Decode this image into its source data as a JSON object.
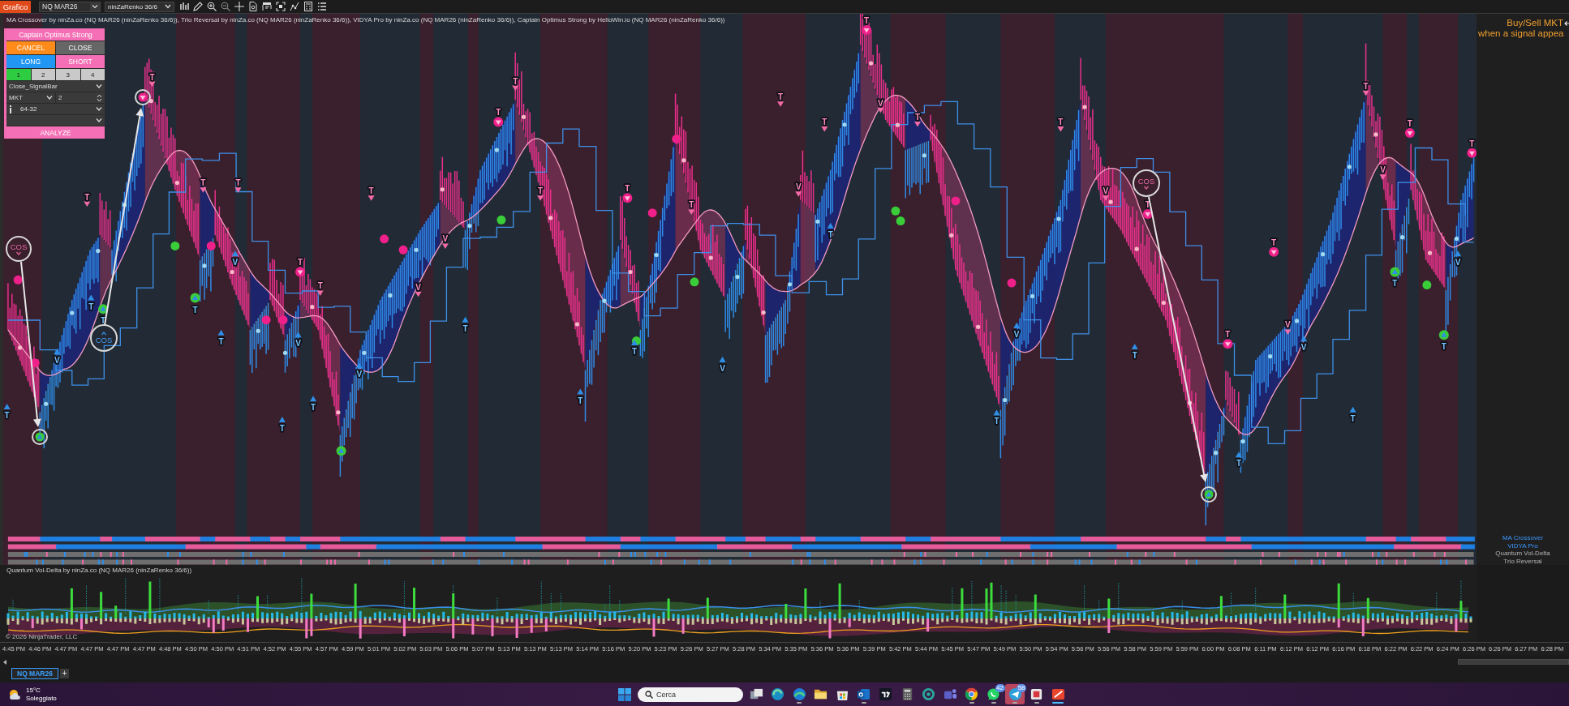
{
  "toolbar": {
    "window_tab": "Grafico",
    "instrument": "NQ MAR26",
    "bar_type": "ninZaRenko 36/6"
  },
  "chart": {
    "title": "MA Crossover by ninZa.co (NQ MAR26 (ninZaRenko 36/6)), Trio Reversal by ninZa.co (NQ MAR26 (ninZaRenko 36/6)), VIDYA Pro by ninZa.co (NQ MAR26 (ninZaRenko 36/6)), Captain Optimus Strong by HelloWin.io (NQ MAR26 (ninZaRenko 36/6))",
    "notice": [
      "Buy/Sell MKT",
      "when a signal appea"
    ],
    "annotations": [
      {
        "label": "COS",
        "kind": "sell"
      },
      {
        "label": "COS",
        "kind": "buy"
      },
      {
        "label": "COS",
        "kind": "sell"
      }
    ],
    "signals": [
      {
        "kind": "buy",
        "label": "T"
      },
      {
        "kind": "buy",
        "label": "V"
      },
      {
        "kind": "sell",
        "label": "T"
      },
      {
        "kind": "buy",
        "label": "T"
      },
      {
        "kind": "buycircle",
        "label": "T"
      },
      {
        "kind": "sell",
        "label": "T"
      },
      {
        "kind": "buycircle",
        "label": "T"
      },
      {
        "kind": "sell",
        "label": "T"
      },
      {
        "kind": "buy",
        "label": "T"
      },
      {
        "kind": "buy",
        "label": "V"
      },
      {
        "kind": "sell",
        "label": "T"
      },
      {
        "kind": "buy",
        "label": "T"
      },
      {
        "kind": "buy",
        "label": "V"
      },
      {
        "kind": "sellcircle",
        "label": "T"
      },
      {
        "kind": "buy",
        "label": "T"
      },
      {
        "kind": "sell",
        "label": "T"
      },
      {
        "kind": "buy",
        "label": "V"
      },
      {
        "kind": "sell",
        "label": "T"
      },
      {
        "kind": "sell",
        "label": "V"
      },
      {
        "kind": "sell",
        "label": "V"
      },
      {
        "kind": "buy",
        "label": "T"
      },
      {
        "kind": "sellcircle",
        "label": "T"
      },
      {
        "kind": "sell",
        "label": "T"
      },
      {
        "kind": "sell",
        "label": "T"
      },
      {
        "kind": "buy",
        "label": "T"
      },
      {
        "kind": "sellcircle",
        "label": "T"
      },
      {
        "kind": "buy",
        "label": "T"
      },
      {
        "kind": "sell",
        "label": "T"
      },
      {
        "kind": "buy",
        "label": "V"
      },
      {
        "kind": "sell",
        "label": "T"
      },
      {
        "kind": "sell",
        "label": "V"
      },
      {
        "kind": "sell",
        "label": "T"
      },
      {
        "kind": "buy",
        "label": "T"
      },
      {
        "kind": "sellcircle",
        "label": "T"
      },
      {
        "kind": "sell",
        "label": "V"
      },
      {
        "kind": "sell",
        "label": "T"
      },
      {
        "kind": "buy",
        "label": "T"
      },
      {
        "kind": "buy",
        "label": "V"
      },
      {
        "kind": "sell",
        "label": "T"
      },
      {
        "kind": "sell",
        "label": "V"
      },
      {
        "kind": "buy",
        "label": "T"
      },
      {
        "kind": "sellcircle",
        "label": "T"
      },
      {
        "kind": "sellcircle",
        "label": "T"
      },
      {
        "kind": "buy",
        "label": "T"
      },
      {
        "kind": "sellcircle",
        "label": "T"
      },
      {
        "kind": "sell",
        "label": "V"
      },
      {
        "kind": "buy",
        "label": "V"
      },
      {
        "kind": "buy",
        "label": "T"
      },
      {
        "kind": "sell",
        "label": "T"
      },
      {
        "kind": "sell",
        "label": "V"
      },
      {
        "kind": "buycircle",
        "label": "T"
      },
      {
        "kind": "sellcircle",
        "label": "T"
      },
      {
        "kind": "buycircle",
        "label": "T"
      },
      {
        "kind": "buy",
        "label": "V"
      },
      {
        "kind": "sellcircle",
        "label": "T"
      }
    ]
  },
  "order_panel": {
    "title": "Captain Optimus Strong",
    "buttons": [
      {
        "label": "CANCEL",
        "kind": "cancel"
      },
      {
        "label": "CLOSE",
        "kind": "close"
      },
      {
        "label": "LONG",
        "kind": "long"
      },
      {
        "label": "SHORT",
        "kind": "short"
      }
    ],
    "presets": [
      {
        "label": "1",
        "selected": true
      },
      {
        "label": "2",
        "selected": false
      },
      {
        "label": "3",
        "selected": false
      },
      {
        "label": "4",
        "selected": false
      }
    ],
    "exit_mode": "Close_SignalBar",
    "order_type": "MKT",
    "quantity": "2",
    "ratio": "64-32",
    "analyze": "ANALYZE"
  },
  "strips": [
    {
      "label": "MA Crossover",
      "kind": "trend"
    },
    {
      "label": "VIDYA Pro",
      "kind": "trend"
    },
    {
      "label": "Quantum Vol-Delta",
      "kind": "ticks"
    },
    {
      "label": "Trio Reversal",
      "kind": "ticks"
    }
  ],
  "lower_panel": {
    "title": "Quantum Vol-Delta by ninZa.co (NQ MAR26 (ninZaRenko 36/6))",
    "copyright": "© 2026 NinjaTrader, LLC"
  },
  "time_axis": [
    "4:45 PM",
    "4:46 PM",
    "4:47 PM",
    "4:47 PM",
    "4:47 PM",
    "4:47 PM",
    "4:48 PM",
    "4:50 PM",
    "4:50 PM",
    "4:51 PM",
    "4:52 PM",
    "4:55 PM",
    "4:57 PM",
    "4:59 PM",
    "5:01 PM",
    "5:02 PM",
    "5:03 PM",
    "5:06 PM",
    "5:07 PM",
    "5:13 PM",
    "5:13 PM",
    "5:13 PM",
    "5:14 PM",
    "5:16 PM",
    "5:20 PM",
    "5:23 PM",
    "5:26 PM",
    "5:27 PM",
    "5:28 PM",
    "5:34 PM",
    "5:35 PM",
    "5:36 PM",
    "5:36 PM",
    "5:39 PM",
    "5:42 PM",
    "5:44 PM",
    "5:45 PM",
    "5:47 PM",
    "5:49 PM",
    "5:50 PM",
    "5:54 PM",
    "5:56 PM",
    "5:56 PM",
    "5:58 PM",
    "5:59 PM",
    "5:59 PM",
    "6:00 PM",
    "6:08 PM",
    "6:11 PM",
    "6:12 PM",
    "6:12 PM",
    "6:16 PM",
    "6:18 PM",
    "6:22 PM",
    "6:22 PM",
    "6:24 PM",
    "6:26 PM",
    "6:26 PM",
    "6:27 PM",
    "6:28 PM"
  ],
  "tabs": [
    {
      "label": "NQ MAR26",
      "selected": true
    }
  ],
  "add_tab": "+",
  "taskbar": {
    "weather": {
      "temperature": "15°C",
      "condition": "Soleggiato"
    },
    "search": {
      "placeholder": "Cerca"
    },
    "apps": [
      {
        "kind": "taskview",
        "running": false,
        "focused": false,
        "flashing": false
      },
      {
        "kind": "swirl",
        "running": false,
        "focused": false,
        "flashing": false
      },
      {
        "kind": "wave",
        "running": true,
        "focused": false,
        "flashing": false
      },
      {
        "kind": "folder",
        "running": false,
        "focused": false,
        "flashing": false
      },
      {
        "kind": "bag",
        "running": false,
        "focused": false,
        "flashing": false
      },
      {
        "kind": "mail",
        "running": true,
        "focused": false,
        "flashing": false
      },
      {
        "kind": "tile",
        "running": false,
        "focused": false,
        "flashing": false
      },
      {
        "kind": "calculator",
        "running": false,
        "focused": false,
        "flashing": false
      },
      {
        "kind": "spiral",
        "running": false,
        "focused": false,
        "flashing": false
      },
      {
        "kind": "people",
        "running": false,
        "focused": false,
        "flashing": false
      },
      {
        "kind": "pinwheel",
        "running": true,
        "focused": false,
        "flashing": false
      },
      {
        "kind": "chat",
        "running": true,
        "focused": false,
        "flashing": false,
        "badge": "42"
      },
      {
        "kind": "plane",
        "running": true,
        "focused": false,
        "flashing": true,
        "badge": "58"
      },
      {
        "kind": "snip",
        "running": true,
        "focused": false,
        "flashing": false
      },
      {
        "kind": "logo",
        "running": true,
        "focused": true,
        "flashing": false
      }
    ]
  }
}
